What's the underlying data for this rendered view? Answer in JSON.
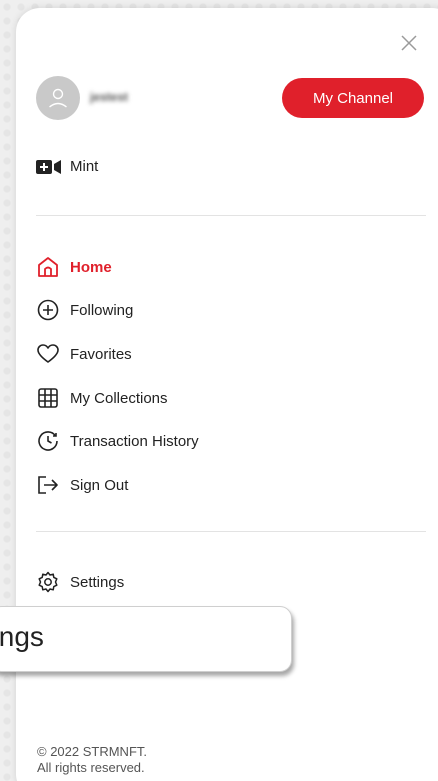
{
  "header": {
    "username": "jestest",
    "channel_button": "My Channel"
  },
  "mint": {
    "label": "Mint"
  },
  "nav": {
    "items": [
      {
        "label": "Home",
        "icon": "home-icon",
        "active": true
      },
      {
        "label": "Following",
        "icon": "plus-circle-icon"
      },
      {
        "label": "Favorites",
        "icon": "heart-icon"
      },
      {
        "label": "My Collections",
        "icon": "grid-icon"
      },
      {
        "label": "Transaction History",
        "icon": "history-icon"
      },
      {
        "label": "Sign Out",
        "icon": "sign-out-icon"
      }
    ]
  },
  "settings": {
    "label": "Settings",
    "icon": "gear-icon"
  },
  "tooltip": {
    "label": "ttings"
  },
  "footer": {
    "copyright": "© 2022 STRMNFT.",
    "rights": "All rights reserved."
  },
  "colors": {
    "accent": "#e0202b",
    "text": "#222222",
    "avatar": "#c9c9c9"
  }
}
